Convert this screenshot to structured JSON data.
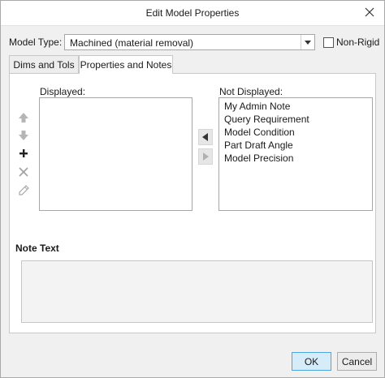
{
  "window": {
    "title": "Edit Model Properties"
  },
  "model_type": {
    "label": "Model Type:",
    "selected": "Machined (material removal)",
    "non_rigid_label": "Non-Rigid",
    "non_rigid_checked": false
  },
  "tabs": [
    {
      "label": "Dims and Tols",
      "active": false
    },
    {
      "label": "Properties and Notes",
      "active": true
    }
  ],
  "properties": {
    "displayed_label": "Displayed:",
    "displayed_items": [],
    "not_displayed_label": "Not Displayed:",
    "not_displayed_items": [
      "My Admin Note",
      "Query Requirement",
      "Model Condition",
      "Part Draft Angle",
      "Model Precision"
    ]
  },
  "note": {
    "label": "Note Text",
    "value": ""
  },
  "buttons": {
    "ok": "OK",
    "cancel": "Cancel"
  },
  "colors": {
    "ok_bg": "#d6ecf9",
    "ok_border": "#4ea4dc"
  },
  "icons": {
    "move_up": "arrow-up-icon",
    "move_down": "arrow-down-icon",
    "add": "plus-icon",
    "delete": "x-icon",
    "edit": "pencil-icon",
    "move_left": "triangle-left-icon",
    "move_right": "triangle-right-icon",
    "close": "close-icon"
  }
}
